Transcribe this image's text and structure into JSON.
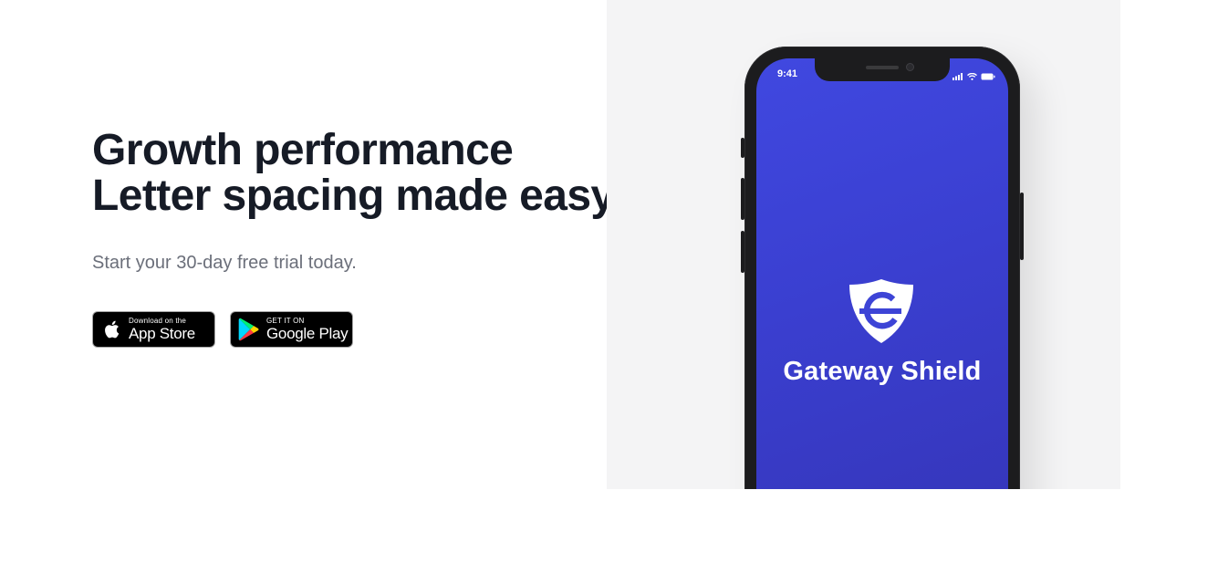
{
  "hero": {
    "headline_line1": "Growth performance",
    "headline_line2": "Letter spacing made easy",
    "subtitle": "Start your 30-day free trial today."
  },
  "store_buttons": {
    "app_store": {
      "small": "Download on the",
      "big": "App Store",
      "icon": "apple-icon"
    },
    "google_play": {
      "small": "GET IT ON",
      "big": "Google Play",
      "icon": "google-play-icon"
    }
  },
  "phone": {
    "status_time": "9:41",
    "app_name": "Gateway Shield",
    "app_logo_icon": "shield-logo-icon",
    "screen_color": "#3d44d6"
  },
  "colors": {
    "headline": "#161b26",
    "subtitle": "#6b6f7a",
    "panel_bg": "#f4f4f5"
  }
}
